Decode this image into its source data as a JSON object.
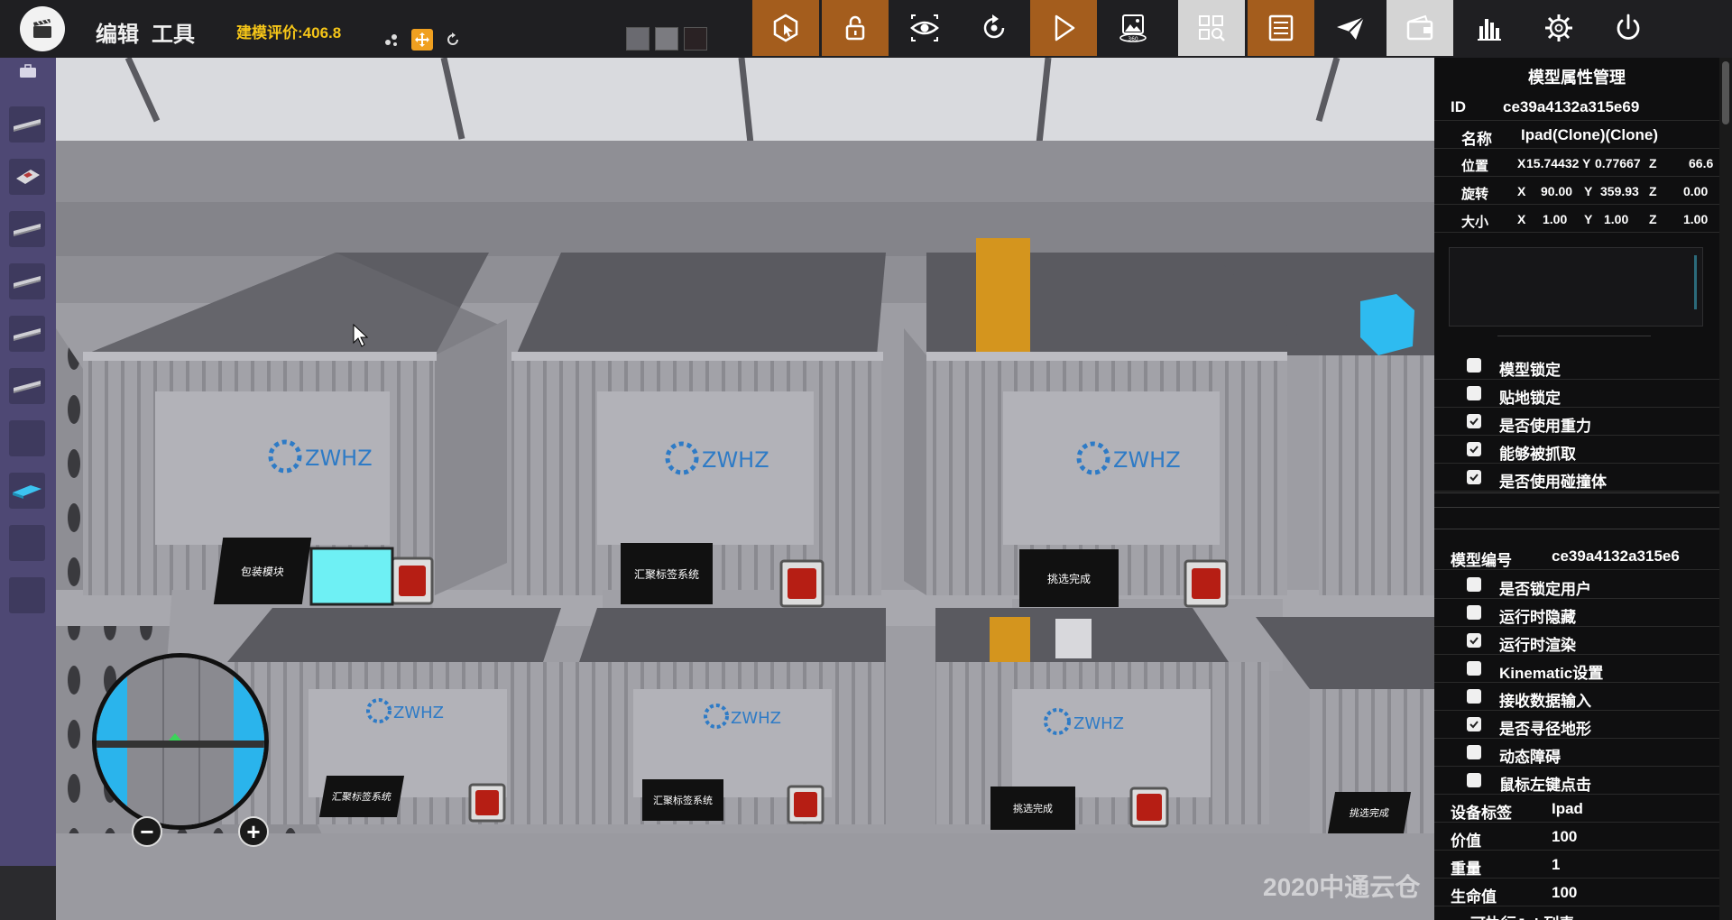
{
  "topbar": {
    "menu": [
      "编辑",
      "工具"
    ],
    "score_text": "建模评价:406.8",
    "small_tools": [
      "scatter-icon",
      "move-icon",
      "rotate-icon"
    ],
    "thumbnails": [
      "thumbnail-1",
      "thumbnail-2",
      "thumbnail-3"
    ],
    "buttons": [
      {
        "icon": "select-model-icon",
        "style": "brown"
      },
      {
        "icon": "lock-icon",
        "style": "brown"
      },
      {
        "icon": "eye-icon",
        "style": "dark"
      },
      {
        "icon": "reset-rotation-icon",
        "style": "dark"
      },
      {
        "icon": "play-icon",
        "style": "brown"
      },
      {
        "icon": "panorama-360-icon",
        "style": "dark"
      },
      {
        "icon": "grid-search-icon",
        "style": "light"
      },
      {
        "icon": "list-icon",
        "style": "brown"
      },
      {
        "icon": "send-icon",
        "style": "dark"
      },
      {
        "icon": "wallet-icon",
        "style": "light"
      },
      {
        "icon": "bar-chart-icon",
        "style": "dark"
      },
      {
        "icon": "settings-icon",
        "style": "dark"
      },
      {
        "icon": "power-icon",
        "style": "dark"
      }
    ]
  },
  "scene": {
    "box_brand": "ZWHZ",
    "labels": {
      "top_1": "包装模块",
      "top_2": "汇聚标签系统",
      "top_3": "挑选完成",
      "bottom_1": "汇聚标签系统",
      "bottom_2": "汇聚标签系统",
      "bottom_3": "挑选完成",
      "bottom_4": "挑选完成"
    },
    "watermark": "2020中通云仓"
  },
  "panel": {
    "title": "模型属性管理",
    "id_label": "ID",
    "id_value": "ce39a4132a315e69",
    "name_label": "名称",
    "name_value": "Ipad(Clone)(Clone)",
    "position_label": "位置",
    "position": {
      "x": "15.74432",
      "y": "0.77667",
      "z": "66.6"
    },
    "rotation_label": "旋转",
    "rotation": {
      "x": "90.00",
      "y": "359.93",
      "z": "0.00"
    },
    "size_label": "大小",
    "size": {
      "x": "1.00",
      "y": "1.00",
      "z": "1.00"
    },
    "axis": {
      "x": "X",
      "y": "Y",
      "z": "Z"
    },
    "flags1": [
      {
        "label": "模型锁定",
        "checked": false
      },
      {
        "label": "贴地锁定",
        "checked": false
      },
      {
        "label": "是否使用重力",
        "checked": true
      },
      {
        "label": "能够被抓取",
        "checked": true
      },
      {
        "label": "是否使用碰撞体",
        "checked": true
      }
    ],
    "model_no_label": "模型编号",
    "model_no_value": "ce39a4132a315e6",
    "flags2": [
      {
        "label": "是否锁定用户",
        "checked": false
      },
      {
        "label": "运行时隐藏",
        "checked": false
      },
      {
        "label": "运行时渲染",
        "checked": true
      },
      {
        "label": "Kinematic设置",
        "checked": false
      },
      {
        "label": "接收数据输入",
        "checked": false
      },
      {
        "label": "是否寻径地形",
        "checked": true
      },
      {
        "label": "动态障碍",
        "checked": false
      },
      {
        "label": "鼠标左键点击",
        "checked": false
      }
    ],
    "device_tag_label": "设备标签",
    "device_tag_value": "Ipad",
    "price_label": "价值",
    "price_value": "100",
    "weight_label": "重量",
    "weight_value": "1",
    "life_label": "生命值",
    "life_value": "100",
    "cut_label": "可执行Job列表"
  }
}
